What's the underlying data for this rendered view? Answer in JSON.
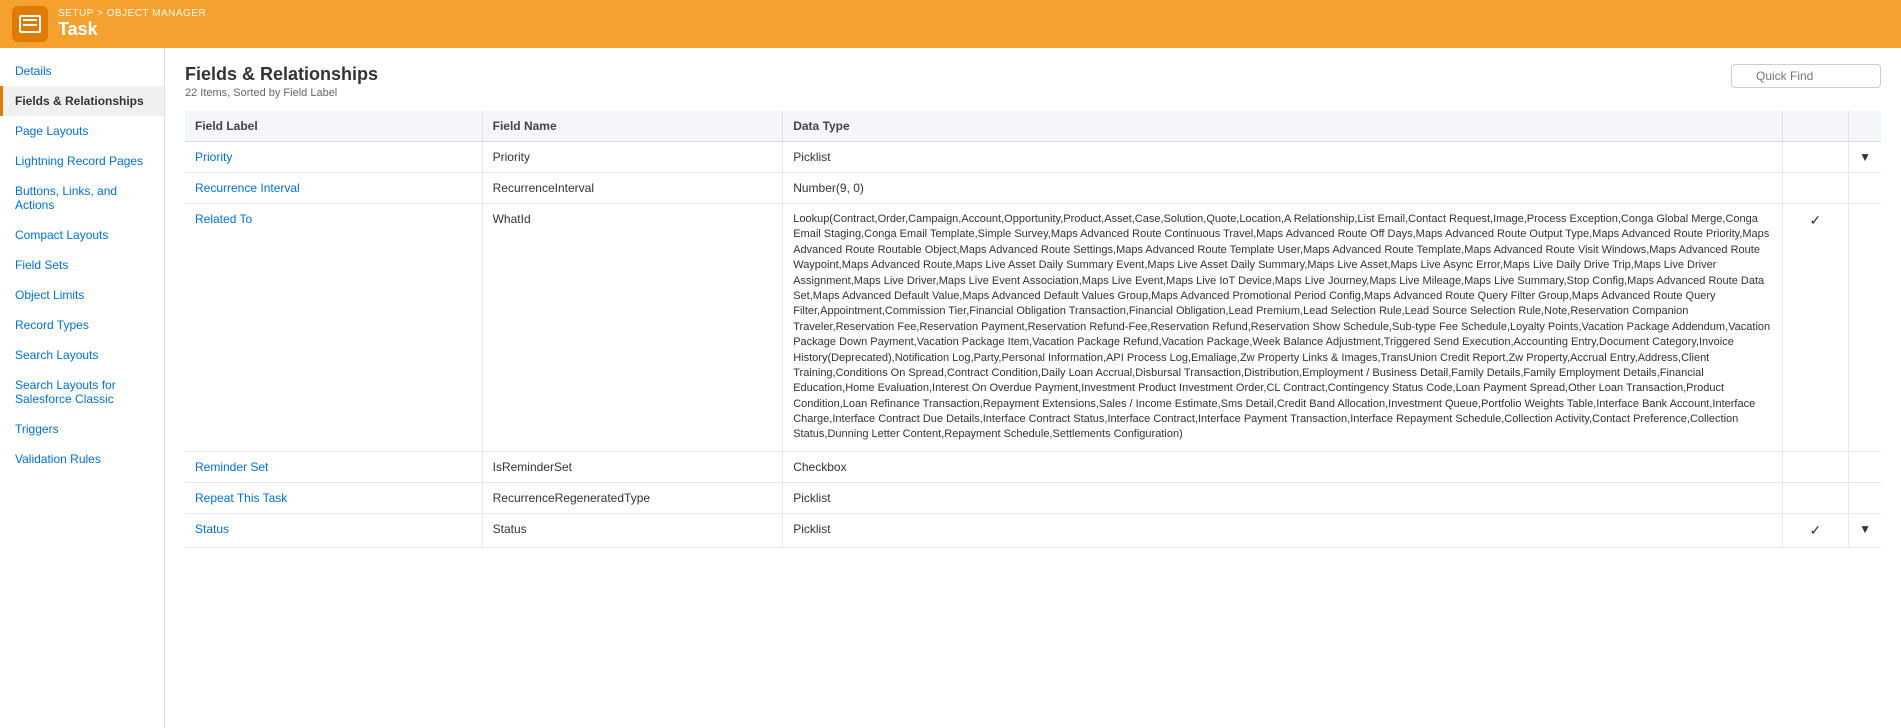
{
  "header": {
    "breadcrumb_setup": "SETUP",
    "breadcrumb_separator": " > ",
    "breadcrumb_object_manager": "OBJECT MANAGER",
    "page_title": "Task"
  },
  "sidebar": {
    "items": [
      {
        "id": "details",
        "label": "Details",
        "active": false
      },
      {
        "id": "fields-relationships",
        "label": "Fields & Relationships",
        "active": true
      },
      {
        "id": "page-layouts",
        "label": "Page Layouts",
        "active": false
      },
      {
        "id": "lightning-record-pages",
        "label": "Lightning Record Pages",
        "active": false
      },
      {
        "id": "buttons-links-actions",
        "label": "Buttons, Links, and Actions",
        "active": false
      },
      {
        "id": "compact-layouts",
        "label": "Compact Layouts",
        "active": false
      },
      {
        "id": "field-sets",
        "label": "Field Sets",
        "active": false
      },
      {
        "id": "object-limits",
        "label": "Object Limits",
        "active": false
      },
      {
        "id": "record-types",
        "label": "Record Types",
        "active": false
      },
      {
        "id": "search-layouts",
        "label": "Search Layouts",
        "active": false
      },
      {
        "id": "search-layouts-classic",
        "label": "Search Layouts for Salesforce Classic",
        "active": false
      },
      {
        "id": "triggers",
        "label": "Triggers",
        "active": false
      },
      {
        "id": "validation-rules",
        "label": "Validation Rules",
        "active": false
      }
    ]
  },
  "main": {
    "title": "Fields & Relationships",
    "subtitle": "22 Items, Sorted by Field Label",
    "quick_find_placeholder": "Quick Find",
    "table": {
      "columns": [
        "Field Label",
        "Field Name",
        "Data Type",
        "",
        ""
      ],
      "rows": [
        {
          "field_label": "Priority",
          "field_label_link": true,
          "field_name": "Priority",
          "data_type": "Picklist",
          "checkmark": false,
          "dropdown": true
        },
        {
          "field_label": "Recurrence Interval",
          "field_label_link": true,
          "field_name": "RecurrenceInterval",
          "data_type": "Number(9, 0)",
          "checkmark": false,
          "dropdown": false
        },
        {
          "field_label": "Related To",
          "field_label_link": true,
          "field_name": "WhatId",
          "data_type": "Lookup(Contract,Order,Campaign,Account,Opportunity,Product,Asset,Case,Solution,Quote,Location,A Relationship,List Email,Contact Request,Image,Process Exception,Conga Global Merge,Conga Email Staging,Conga Email Template,Simple Survey,Maps Advanced Route Continuous Travel,Maps Advanced Route Off Days,Maps Advanced Route Output Type,Maps Advanced Route Priority,Maps Advanced Route Routable Object,Maps Advanced Route Settings,Maps Advanced Route Template User,Maps Advanced Route Template,Maps Advanced Route Visit Windows,Maps Advanced Route Waypoint,Maps Advanced Route,Maps Live Asset Daily Summary Event,Maps Live Asset Daily Summary,Maps Live Asset,Maps Live Async Error,Maps Live Daily Drive Trip,Maps Live Driver Assignment,Maps Live Driver,Maps Live Event Association,Maps Live Event,Maps Live IoT Device,Maps Live Journey,Maps Live Mileage,Maps Live Summary,Stop Config,Maps Advanced Route Data Set,Maps Advanced Default Value,Maps Advanced Default Values Group,Maps Advanced Promotional Period Config,Maps Advanced Route Query Filter Group,Maps Advanced Route Query Filter,Appointment,Commission Tier,Financial Obligation Transaction,Financial Obligation,Lead Premium,Lead Selection Rule,Lead Source Selection Rule,Note,Reservation Companion Traveler,Reservation Fee,Reservation Payment,Reservation Refund-Fee,Reservation Refund,Reservation Show Schedule,Sub-type Fee Schedule,Loyalty Points,Vacation Package Addendum,Vacation Package Down Payment,Vacation Package Item,Vacation Package Refund,Vacation Package,Week Balance Adjustment,Triggered Send Execution,Accounting Entry,Document Category,Invoice History(Deprecated),Notification Log,Party,Personal Information,API Process Log,Emaliage,Zw Property Links & Images,TransUnion Credit Report,Zw Property,Accrual Entry,Address,Client Training,Conditions On Spread,Contract Condition,Daily Loan Accrual,Disbursal Transaction,Distribution,Employment / Business Detail,Family Details,Family Employment Details,Financial Education,Home Evaluation,Interest On Overdue Payment,Investment Product Investment Order,CL Contract,Contingency Status Code,Loan Payment Spread,Other Loan Transaction,Product Condition,Loan Refinance Transaction,Repayment Extensions,Sales / Income Estimate,Sms Detail,Credit Band Allocation,Investment Queue,Portfolio Weights Table,Interface Bank Account,Interface Charge,Interface Contract Due Details,Interface Contract Status,Interface Contract,Interface Payment Transaction,Interface Repayment Schedule,Collection Activity,Contact Preference,Collection Status,Dunning Letter Content,Repayment Schedule,Settlements Configuration)",
          "checkmark": true,
          "dropdown": false
        },
        {
          "field_label": "Reminder Set",
          "field_label_link": true,
          "field_name": "IsReminderSet",
          "data_type": "Checkbox",
          "checkmark": false,
          "dropdown": false
        },
        {
          "field_label": "Repeat This Task",
          "field_label_link": true,
          "field_name": "RecurrenceRegeneratedType",
          "data_type": "Picklist",
          "checkmark": false,
          "dropdown": false
        },
        {
          "field_label": "Status",
          "field_label_link": true,
          "field_name": "Status",
          "data_type": "Picklist",
          "checkmark": true,
          "dropdown": true
        }
      ]
    }
  }
}
